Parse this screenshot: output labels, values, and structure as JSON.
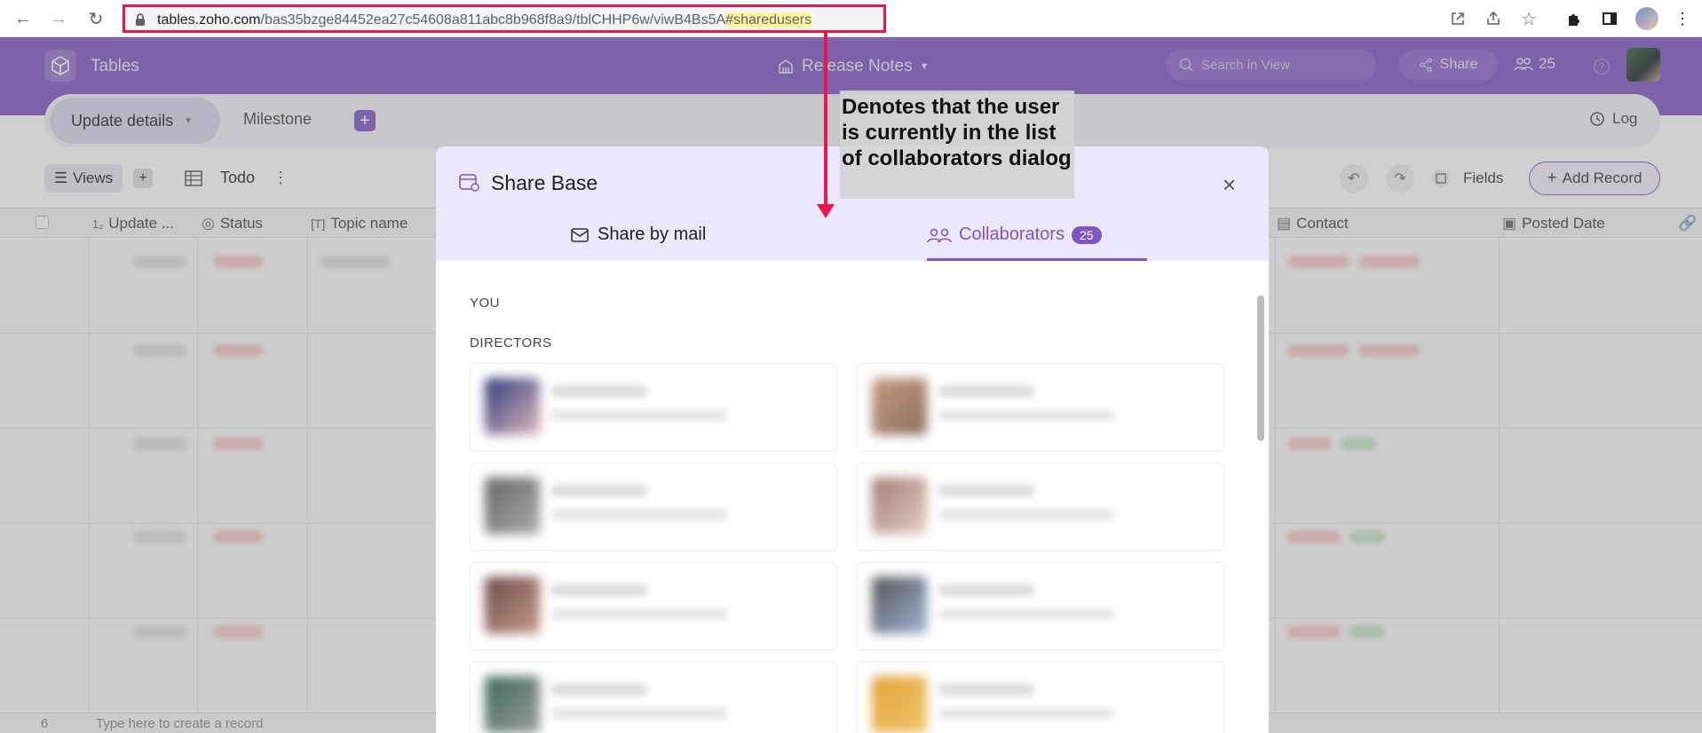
{
  "browser": {
    "url_domain": "tables.zoho.com",
    "url_path": "/bas35bzge84452ea27c54608a811abc8b968f8a9/tblCHHP6w/viwB4Bs5A",
    "url_hash": "#sharedusers"
  },
  "app": {
    "name": "Tables",
    "base_title": "Release Notes",
    "search_placeholder": "Search in View",
    "share_label": "Share",
    "collaborator_count": "25"
  },
  "tabs": {
    "active": "Update details",
    "second": "Milestone",
    "add": "+",
    "log": "Log"
  },
  "toolbar": {
    "views": "Views",
    "views_add": "+",
    "view_name": "Todo",
    "fields": "Fields",
    "add_record": "Add Record"
  },
  "grid": {
    "columns": [
      "Update ...",
      "Status",
      "Topic name",
      "Contact",
      "Posted Date"
    ],
    "footer_row": "6",
    "footer_placeholder": "Type here to create a record"
  },
  "modal": {
    "title": "Share Base",
    "tab_mail": "Share by mail",
    "tab_collaborators": "Collaborators",
    "collaborators_badge": "25",
    "section_you": "YOU",
    "section_directors": "DIRECTORS",
    "close": "×"
  },
  "annotation": {
    "text": "Denotes that the user is currently in the list of collaborators dialog"
  },
  "colors": {
    "brand_purple": "#7e57c2",
    "annotation_red": "#e8174e",
    "highlight_yellow": "#fff59d"
  }
}
